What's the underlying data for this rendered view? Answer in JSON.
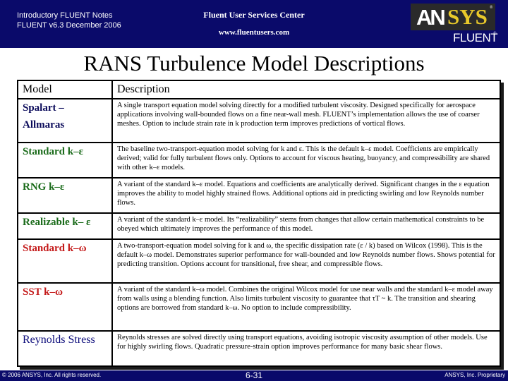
{
  "header": {
    "course_line": "Introductory FLUENT Notes",
    "version_line": "FLUENT v6.3  December 2006",
    "center_title": "Fluent User Services Center",
    "center_url": "www.fluentusers.com",
    "logo": {
      "part1": "AN",
      "part2": "SYS",
      "sub": "FLUENT",
      "reg": "®",
      "accent_color": "#e8c82a"
    }
  },
  "title": "RANS Turbulence Model Descriptions",
  "table": {
    "columns": [
      "Model",
      "Description"
    ],
    "rows": [
      {
        "model": "Spalart – Allmaras",
        "color": "#0a0a5a",
        "description": "A single transport equation model solving directly for a modified turbulent viscosity.  Designed specifically for aerospace applications involving wall-bounded flows on a fine near-wall mesh.  FLUENT’s implementation allows the use of coarser meshes.  Option to include strain rate in k production term improves predictions of vortical flows."
      },
      {
        "model": "Standard k–ε",
        "color": "#1a6b1a",
        "description": "The baseline two-transport-equation model solving for k and ε.  This is the default k–ε  model.  Coefficients are empirically derived; valid for fully turbulent flows only.  Options to account for viscous heating, buoyancy, and compressibility are shared with other k–ε models."
      },
      {
        "model": "RNG k–ε",
        "color": "#1a6b1a",
        "description": "A variant of the standard k–ε model.  Equations and coefficients are analytically derived.  Significant changes in the ε equation improves the ability to model highly strained flows.  Additional options aid in predicting swirling and low Reynolds number flows."
      },
      {
        "model": "Realizable k– ε",
        "color": "#1a6b1a",
        "description": "A variant of the standard k–ε model.  Its “realizability” stems from changes that allow certain mathematical constraints to be obeyed which ultimately improves the performance of this model."
      },
      {
        "model": "Standard k–ω",
        "color": "#c41a1a",
        "description": "A two-transport-equation model solving for k and ω, the specific dissipation rate (ε / k) based on Wilcox (1998).  This is the default k–ω model.  Demonstrates superior performance for wall-bounded and low Reynolds number flows.  Shows potential for predicting transition.  Options account for transitional, free shear, and compressible flows."
      },
      {
        "model": "SST k–ω",
        "color": "#c41a1a",
        "description": "A variant of the standard k–ω model.  Combines the original Wilcox model for use near walls and the standard k–ε model away from walls using a blending function.  Also limits turbulent viscosity to guarantee that τT ~ k.  The transition and shearing options are borrowed from standard k–ω.  No option to include compressibility."
      },
      {
        "model": "Reynolds Stress",
        "color": "#0a0a7a",
        "description": "Reynolds stresses are solved directly using transport equations, avoiding isotropic viscosity assumption of other models.  Use for highly swirling flows.  Quadratic pressure-strain option improves performance for many basic shear flows."
      }
    ]
  },
  "footer": {
    "copyright": "© 2006 ANSYS, Inc.  All rights reserved.",
    "page_number": "6-31",
    "proprietary": "ANSYS, Inc. Proprietary"
  }
}
